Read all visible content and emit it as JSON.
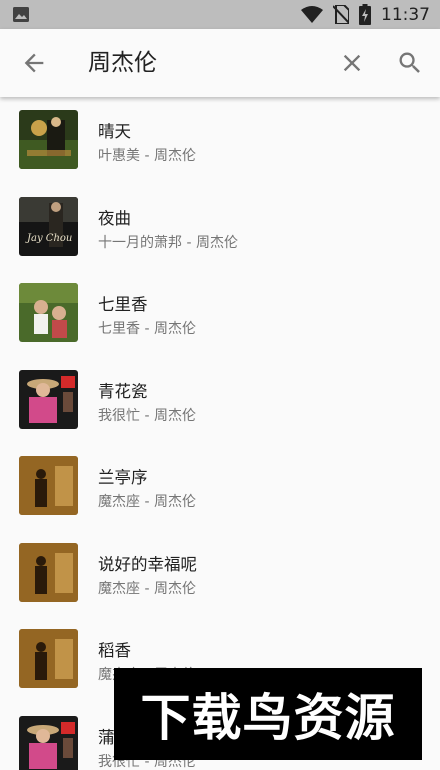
{
  "statusbar": {
    "time": "11:37"
  },
  "toolbar": {
    "query": "周杰伦"
  },
  "songs": [
    {
      "title": "晴天",
      "subtitle": "叶惠美 - 周杰伦",
      "cover": "album-yehuimei"
    },
    {
      "title": "夜曲",
      "subtitle": "十一月的萧邦 - 周杰伦",
      "cover": "album-november-chopin"
    },
    {
      "title": "七里香",
      "subtitle": "七里香 - 周杰伦",
      "cover": "album-qilixiang"
    },
    {
      "title": "青花瓷",
      "subtitle": "我很忙 - 周杰伦",
      "cover": "album-wohenmang"
    },
    {
      "title": "兰亭序",
      "subtitle": "魔杰座 - 周杰伦",
      "cover": "album-mojiezuo"
    },
    {
      "title": "说好的幸福呢",
      "subtitle": "魔杰座 - 周杰伦",
      "cover": "album-mojiezuo"
    },
    {
      "title": "稻香",
      "subtitle": "魔杰座 - 周杰伦",
      "cover": "album-mojiezuo"
    },
    {
      "title": "蒲公英的约定",
      "subtitle": "我很忙 - 周杰伦",
      "cover": "album-wohenmang"
    }
  ],
  "watermark": {
    "text": "下载鸟资源"
  }
}
